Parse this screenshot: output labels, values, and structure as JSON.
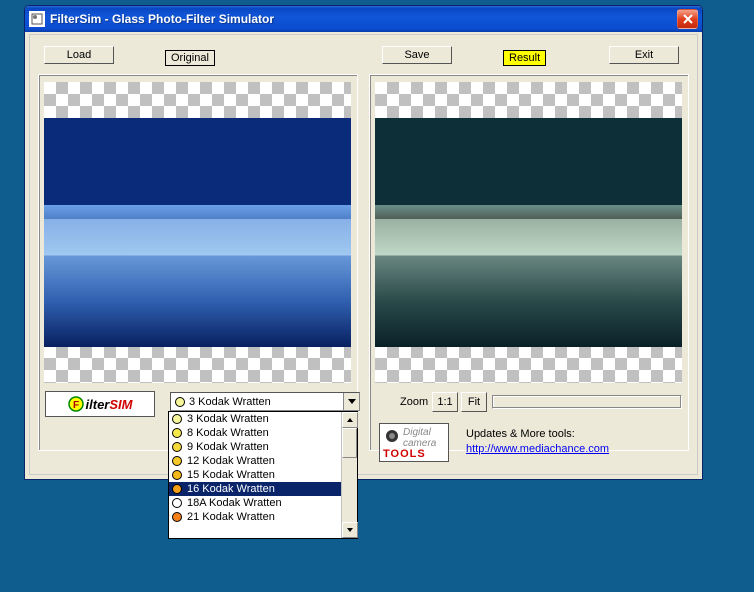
{
  "window": {
    "title": "FilterSim - Glass Photo-Filter Simulator"
  },
  "toolbar": {
    "load": "Load",
    "save": "Save",
    "exit": "Exit",
    "original_label": "Original",
    "result_label": "Result"
  },
  "zoom": {
    "label": "Zoom",
    "btn_1_1": "1:1",
    "btn_fit": "Fit"
  },
  "filter_combo": {
    "selected": {
      "label": "3 Kodak Wratten",
      "color": "#f5f59a"
    },
    "options": [
      {
        "label": "3 Kodak Wratten",
        "color": "#f5f59a"
      },
      {
        "label": "8 Kodak Wratten",
        "color": "#f5e84a"
      },
      {
        "label": "9 Kodak Wratten",
        "color": "#f5d83a"
      },
      {
        "label": "12 Kodak Wratten",
        "color": "#f5c82a"
      },
      {
        "label": "15 Kodak Wratten",
        "color": "#f5b81a"
      },
      {
        "label": "16 Kodak Wratten",
        "color": "#f5a018"
      },
      {
        "label": "18A Kodak Wratten",
        "color": "#ffffff"
      },
      {
        "label": "21 Kodak Wratten",
        "color": "#f58018"
      }
    ],
    "highlighted_index": 5
  },
  "logos": {
    "filtersim_prefix": "ilter",
    "filtersim_suffix": "SIM",
    "tools_line1": "Digital",
    "tools_line2": "camera",
    "tools_line3": "TOOLS"
  },
  "footer": {
    "updates": "Updates & More tools:",
    "url": "http://www.mediachance.com"
  }
}
